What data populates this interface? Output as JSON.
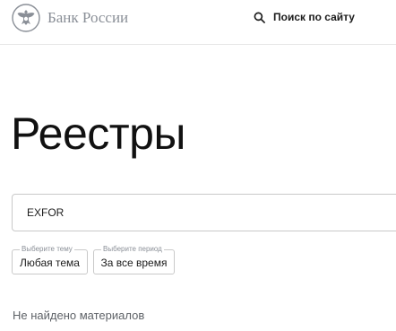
{
  "header": {
    "logo_text": "Банк России",
    "search_label": "Поиск по сайту",
    "logo_icon": "eagle-emblem-icon",
    "search_icon": "search-icon"
  },
  "main": {
    "title": "Реестры",
    "search": {
      "value": "EXFOR"
    },
    "filters": [
      {
        "legend": "Выберите тему",
        "value": "Любая тема"
      },
      {
        "legend": "Выберите период",
        "value": "За все время"
      }
    ],
    "empty_message": "Не найдено материалов"
  },
  "colors": {
    "logo_gray": "#8a8f97",
    "text": "#1c1c1c",
    "border": "#c9c9c9"
  }
}
